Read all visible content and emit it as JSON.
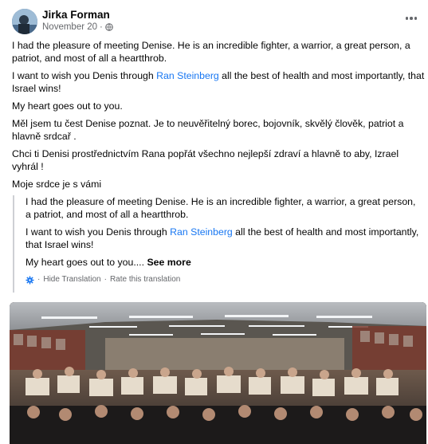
{
  "post": {
    "author": "Jirka Forman",
    "date": "November 20",
    "date_sep": "·",
    "privacy_icon": "globe-icon",
    "paragraphs": [
      "I had the pleasure of meeting Denise. He is an incredible fighter, a warrior, a great person, a patriot, and most of all a heartthrob.",
      null,
      "My heart goes out to you.",
      "Měl jsem tu čest Denise poznat. Je to neuvěřitelný borec, bojovník, skvělý člověk, patriot a hlavně srdcař .",
      "Chci ti Denisi prostřednictvím Rana popřát všechno nejlepší zdraví a hlavně to aby, Izrael vyhrál ! ",
      "Moje srdce je s vámi "
    ],
    "p2": {
      "before": "I want to wish you Denis through ",
      "link": "Ran Steinberg",
      "after": " all the best of health and most importantly, that Israel wins!"
    }
  },
  "translation": {
    "p1": "I had the pleasure of meeting Denise. He is an incredible fighter, a warrior, a great person, a patriot, and most of all a heartthrob.",
    "p2": {
      "before": "I want to wish you Denis through ",
      "link": "Ran Steinberg",
      "after": " all the best of health and most importantly, that Israel wins!"
    },
    "p3": "My heart goes out to you.... ",
    "see_more": "See more",
    "gear_icon": "gear-icon",
    "sep": " · ",
    "hide": "Hide Translation",
    "rate": "Rate this translation"
  },
  "more_icon": "more-horizontal-icon",
  "photo_description_icon": "group-photo"
}
